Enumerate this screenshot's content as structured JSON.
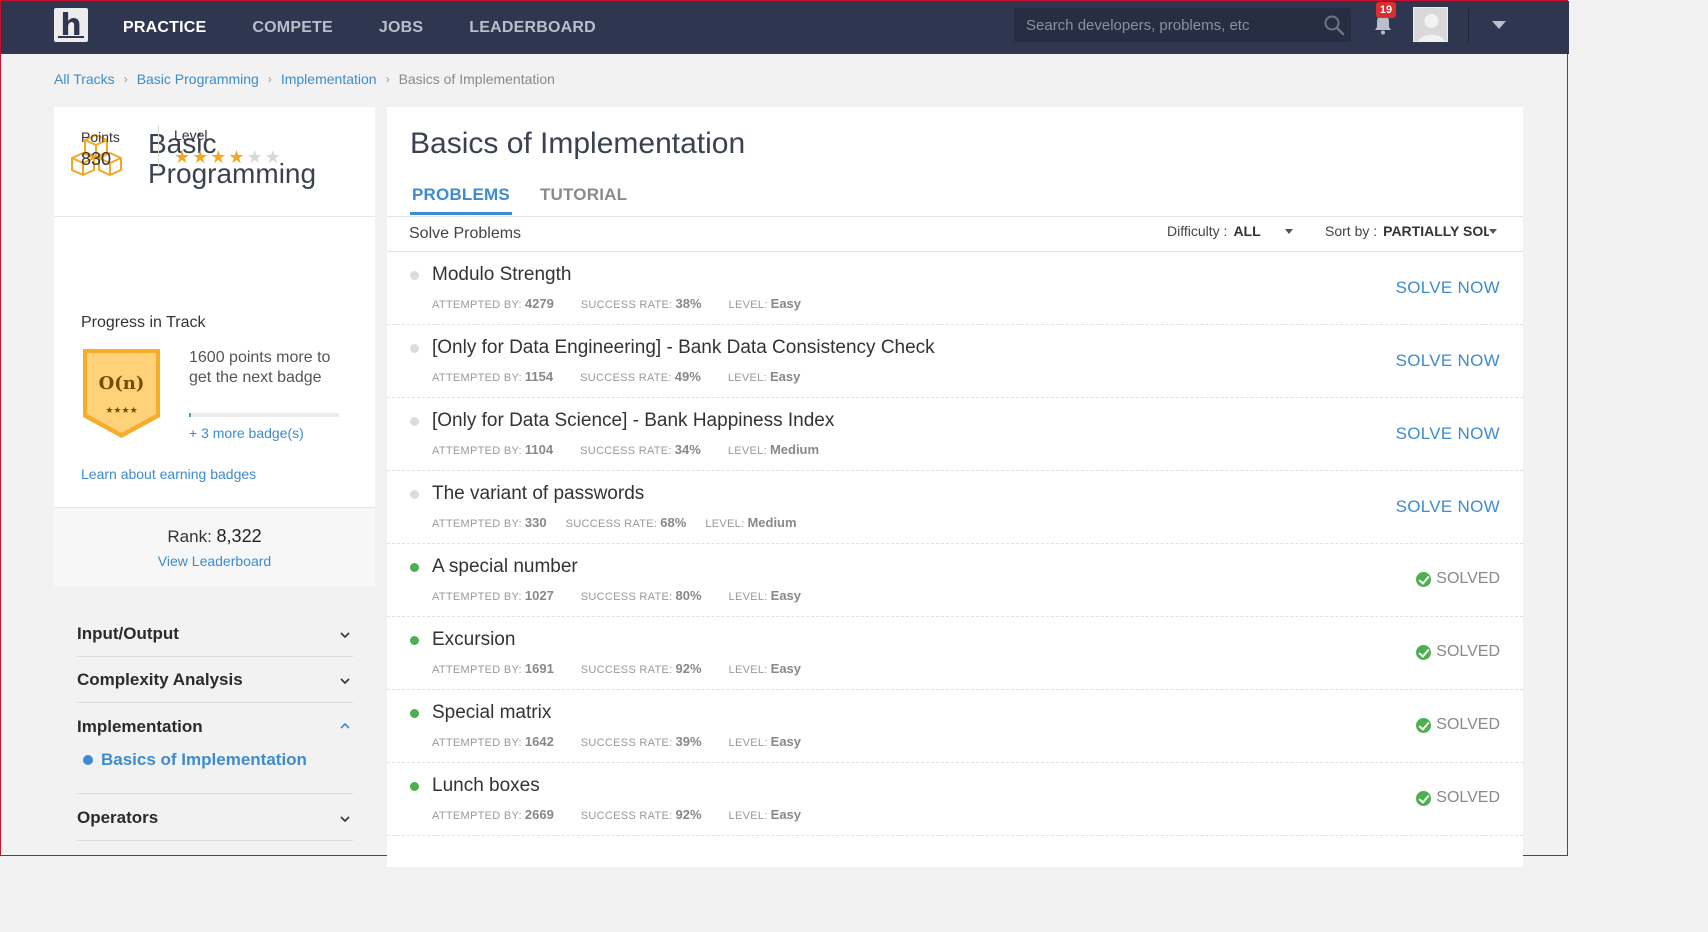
{
  "nav": {
    "logo": "h",
    "links": [
      "PRACTICE",
      "COMPETE",
      "JOBS",
      "LEADERBOARD"
    ],
    "search_placeholder": "Search developers, problems, etc",
    "notification_count": "19"
  },
  "breadcrumb": [
    "All Tracks",
    "Basic Programming",
    "Implementation",
    "Basics of Implementation"
  ],
  "track": {
    "title": "Basic Programming",
    "points_label": "Points",
    "points": "830",
    "level_label": "Level",
    "level_stars": 4,
    "level_max": 6,
    "progress_label": "Progress in Track",
    "badge_symbol": "O(n)",
    "badge_stars": "★★★★",
    "badge_text": "1600 points more to get the next badge",
    "badge_progress": 0.01,
    "more_badges": "+ 3 more badge(s)",
    "learn_link": "Learn about earning badges",
    "rank_label": "Rank:",
    "rank_value": "8,322",
    "view_leaderboard": "View Leaderboard"
  },
  "accordion": {
    "items": [
      "Input/Output",
      "Complexity Analysis",
      "Implementation",
      "Operators"
    ],
    "active_sub": "Basics of Implementation"
  },
  "main": {
    "title": "Basics of Implementation",
    "tabs": [
      "PROBLEMS",
      "TUTORIAL"
    ],
    "solve_label": "Solve Problems",
    "difficulty_label": "Difficulty :",
    "difficulty_value": "ALL",
    "sort_label": "Sort by :",
    "sort_value": "PARTIALLY SOLVED",
    "meta_labels": {
      "attempted": "ATTEMPTED BY:",
      "success": "SUCCESS RATE:",
      "level": "LEVEL:"
    },
    "solve_now": "SOLVE NOW",
    "solved": "SOLVED",
    "problems": [
      {
        "name": "Modulo Strength",
        "attempted": "4279",
        "success": "38%",
        "level": "Easy",
        "solved": false
      },
      {
        "name": "[Only for Data Engineering] - Bank Data Consistency Check",
        "attempted": "1154",
        "success": "49%",
        "level": "Easy",
        "solved": false
      },
      {
        "name": "[Only for Data Science] - Bank Happiness Index",
        "attempted": "1104",
        "success": "34%",
        "level": "Medium",
        "solved": false
      },
      {
        "name": "The variant of passwords",
        "attempted": "330",
        "success": "68%",
        "level": "Medium",
        "solved": false
      },
      {
        "name": "A special number",
        "attempted": "1027",
        "success": "80%",
        "level": "Easy",
        "solved": true
      },
      {
        "name": "Excursion",
        "attempted": "1691",
        "success": "92%",
        "level": "Easy",
        "solved": true
      },
      {
        "name": "Special matrix",
        "attempted": "1642",
        "success": "39%",
        "level": "Easy",
        "solved": true
      },
      {
        "name": "Lunch boxes",
        "attempted": "2669",
        "success": "92%",
        "level": "Easy",
        "solved": true
      }
    ]
  }
}
